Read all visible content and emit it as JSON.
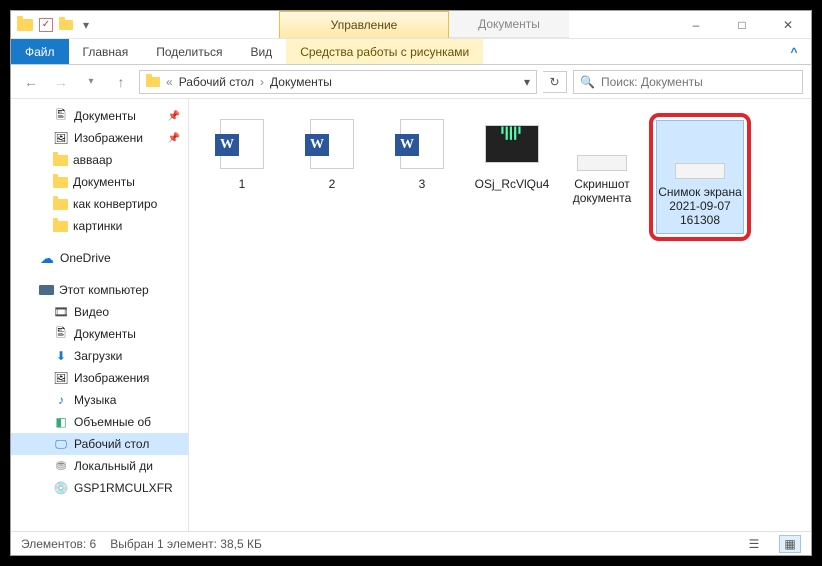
{
  "titlebar": {
    "manage": "Управление",
    "documents": "Документы"
  },
  "ribbon": {
    "file": "Файл",
    "home": "Главная",
    "share": "Поделиться",
    "view": "Вид",
    "pictools": "Средства работы с рисунками"
  },
  "address": {
    "crumb1": "Рабочий стол",
    "crumb2": "Документы"
  },
  "search": {
    "placeholder": "Поиск: Документы"
  },
  "tree": {
    "qa_docs": "Документы",
    "qa_images": "Изображени",
    "qa_avvaar": "авваар",
    "qa_docs2": "Документы",
    "qa_convert": "как конвертиро",
    "qa_pics": "картинки",
    "onedrive": "OneDrive",
    "thispc": "Этот компьютер",
    "video": "Видео",
    "pc_docs": "Документы",
    "downloads": "Загрузки",
    "pc_images": "Изображения",
    "music": "Музыка",
    "volumes": "Объемные об",
    "desktop": "Рабочий стол",
    "localdisk": "Локальный ди",
    "gsp": "GSP1RMCULXFR"
  },
  "items": {
    "i1": "1",
    "i2": "2",
    "i3": "3",
    "i4": "OSj_RcVlQu4",
    "i5": "Скриншот документа",
    "i6": "Снимок экрана 2021-09-07 161308"
  },
  "status": {
    "count": "Элементов: 6",
    "selection": "Выбран 1 элемент: 38,5 КБ"
  }
}
